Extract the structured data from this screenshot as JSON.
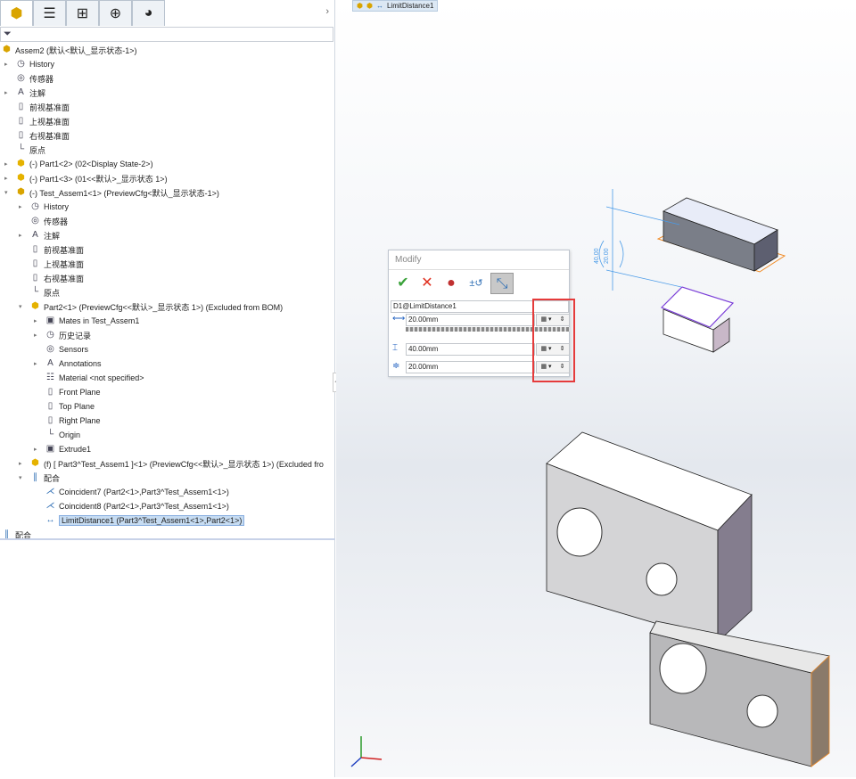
{
  "tabs": [
    {
      "name": "feature-manager",
      "glyph": "⬢"
    },
    {
      "name": "property-manager",
      "glyph": "☰"
    },
    {
      "name": "configuration-manager",
      "glyph": "⊞"
    },
    {
      "name": "dimxpert",
      "glyph": "⊕"
    },
    {
      "name": "display-manager",
      "glyph": "◕"
    }
  ],
  "expand_glyph": "›",
  "filter_glyph": "⏷",
  "tree": [
    {
      "level": 0,
      "toggle": "",
      "icon": "assembly",
      "label": "Assem2  (默认<默认_显示状态-1>)"
    },
    {
      "level": 1,
      "toggle": "▸",
      "icon": "history",
      "label": "History"
    },
    {
      "level": 1,
      "toggle": "",
      "icon": "sensor",
      "label": "传感器"
    },
    {
      "level": 1,
      "toggle": "▸",
      "icon": "annotation",
      "label": "注解"
    },
    {
      "level": 1,
      "toggle": "",
      "icon": "plane",
      "label": "前视基准面"
    },
    {
      "level": 1,
      "toggle": "",
      "icon": "plane",
      "label": "上视基准面"
    },
    {
      "level": 1,
      "toggle": "",
      "icon": "plane",
      "label": "右视基准面"
    },
    {
      "level": 1,
      "toggle": "",
      "icon": "origin",
      "label": "原点"
    },
    {
      "level": 1,
      "toggle": "▸",
      "icon": "part",
      "label": "(-) Part1<2>  (02<Display State-2>)"
    },
    {
      "level": 1,
      "toggle": "▸",
      "icon": "part",
      "label": "(-) Part1<3>  (01<<默认>_显示状态 1>)"
    },
    {
      "level": 1,
      "toggle": "▾",
      "icon": "assembly",
      "label": "(-) Test_Assem1<1>  (PreviewCfg<默认_显示状态-1>)"
    },
    {
      "level": 2,
      "toggle": "▸",
      "icon": "history",
      "label": "History"
    },
    {
      "level": 2,
      "toggle": "",
      "icon": "sensor",
      "label": "传感器"
    },
    {
      "level": 2,
      "toggle": "▸",
      "icon": "annotation",
      "label": "注解"
    },
    {
      "level": 2,
      "toggle": "",
      "icon": "plane",
      "label": "前视基准面"
    },
    {
      "level": 2,
      "toggle": "",
      "icon": "plane",
      "label": "上视基准面"
    },
    {
      "level": 2,
      "toggle": "",
      "icon": "plane",
      "label": "右视基准面"
    },
    {
      "level": 2,
      "toggle": "",
      "icon": "origin",
      "label": "原点"
    },
    {
      "level": 2,
      "toggle": "▾",
      "icon": "part",
      "label": "Part2<1>  (PreviewCfg<<默认>_显示状态 1>) (Excluded from BOM)"
    },
    {
      "level": 3,
      "toggle": "▸",
      "icon": "mates-folder",
      "label": "Mates in Test_Assem1"
    },
    {
      "level": 3,
      "toggle": "▸",
      "icon": "history",
      "label": "历史记录"
    },
    {
      "level": 3,
      "toggle": "",
      "icon": "sensor",
      "label": "Sensors"
    },
    {
      "level": 3,
      "toggle": "▸",
      "icon": "annotation",
      "label": "Annotations"
    },
    {
      "level": 3,
      "toggle": "",
      "icon": "material",
      "label": "Material <not specified>"
    },
    {
      "level": 3,
      "toggle": "",
      "icon": "plane",
      "label": "Front Plane"
    },
    {
      "level": 3,
      "toggle": "",
      "icon": "plane",
      "label": "Top Plane"
    },
    {
      "level": 3,
      "toggle": "",
      "icon": "plane",
      "label": "Right Plane"
    },
    {
      "level": 3,
      "toggle": "",
      "icon": "origin",
      "label": "Origin"
    },
    {
      "level": 3,
      "toggle": "▸",
      "icon": "extrude",
      "label": "Extrude1"
    },
    {
      "level": 2,
      "toggle": "▸",
      "icon": "part",
      "label": "(f) [ Part3^Test_Assem1 ]<1>  (PreviewCfg<<默认>_显示状态 1>) (Excluded fro"
    },
    {
      "level": 2,
      "toggle": "▾",
      "icon": "mates",
      "label": "配合"
    },
    {
      "level": 3,
      "toggle": "",
      "icon": "coincident",
      "label": "Coincident7 (Part2<1>,Part3^Test_Assem1<1>)"
    },
    {
      "level": 3,
      "toggle": "",
      "icon": "coincident",
      "label": "Coincident8 (Part2<1>,Part3^Test_Assem1<1>)"
    },
    {
      "level": 3,
      "toggle": "",
      "icon": "limit-distance",
      "label": "LimitDistance1 (Part3^Test_Assem1<1>,Part2<1>)",
      "selected": true
    },
    {
      "level": 0,
      "toggle": "",
      "icon": "mates",
      "label": "配合"
    }
  ],
  "icon_glyphs": {
    "assembly": "⬢",
    "history": "◷",
    "sensor": "◎",
    "annotation": "A",
    "plane": "▯",
    "origin": "└",
    "part": "⬢",
    "mates-folder": "▣",
    "material": "☷",
    "extrude": "▣",
    "mates": "∥",
    "coincident": "⋌",
    "limit-distance": "↔"
  },
  "icon_colors": {
    "assembly": "#d9a400",
    "part": "#e5b200",
    "mates": "#2f6fb5",
    "coincident": "#2f6fb5",
    "limit-distance": "#2f6fb5"
  },
  "breadcrumb": {
    "label": "LimitDistance1"
  },
  "modify": {
    "title": "Modify",
    "ok": "✔",
    "cancel": "✕",
    "rebuild": "●",
    "reverse": "±↺",
    "mark": "⤡",
    "dimension_name": "D1@LimitDistance1",
    "values": [
      {
        "icon": "distance",
        "glyph": "⟷",
        "value": "20.00mm"
      },
      {
        "icon": "max-distance",
        "glyph": "⌶",
        "value": "40.00mm"
      },
      {
        "icon": "min-distance",
        "glyph": "≑",
        "value": "20.00mm"
      }
    ],
    "config_glyph": "▦ ▾",
    "spin_glyph": "⇕"
  },
  "annotation": {
    "max": "40.00",
    "min": "20.00"
  },
  "colors": {
    "accent": "#2f6fb5",
    "highlight": "#e53b3b",
    "selection": "#c6dcf2"
  }
}
